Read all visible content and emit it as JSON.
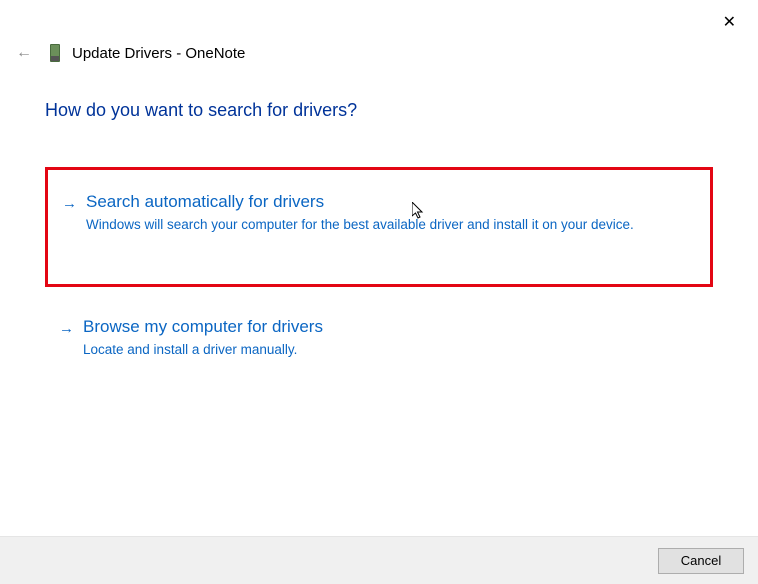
{
  "window": {
    "title": "Update Drivers - OneNote"
  },
  "heading": "How do you want to search for drivers?",
  "options": {
    "auto": {
      "title": "Search automatically for drivers",
      "desc": "Windows will search your computer for the best available driver and install it on your device."
    },
    "browse": {
      "title": "Browse my computer for drivers",
      "desc": "Locate and install a driver manually."
    }
  },
  "footer": {
    "cancel": "Cancel"
  }
}
